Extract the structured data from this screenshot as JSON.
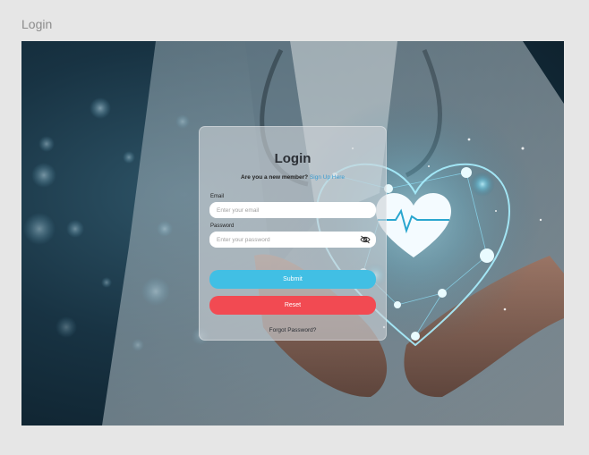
{
  "frame": {
    "label": "Login"
  },
  "login": {
    "title": "Login",
    "signup_prompt": "Are you a new member?",
    "signup_link": "Sign Up Here",
    "email_label": "Email",
    "email_placeholder": "Enter your email",
    "password_label": "Password",
    "password_placeholder": "Enter your password",
    "submit_label": "Submit",
    "reset_label": "Reset",
    "forgot_label": "Forgot Password?"
  },
  "icons": {
    "password_toggle": "eye-off-icon",
    "hero_heart": "heart-pulse-icon"
  },
  "colors": {
    "submit": "#41bfe4",
    "reset": "#f24a52",
    "link": "#3a9bd0",
    "glow": "#8fe6ff"
  }
}
